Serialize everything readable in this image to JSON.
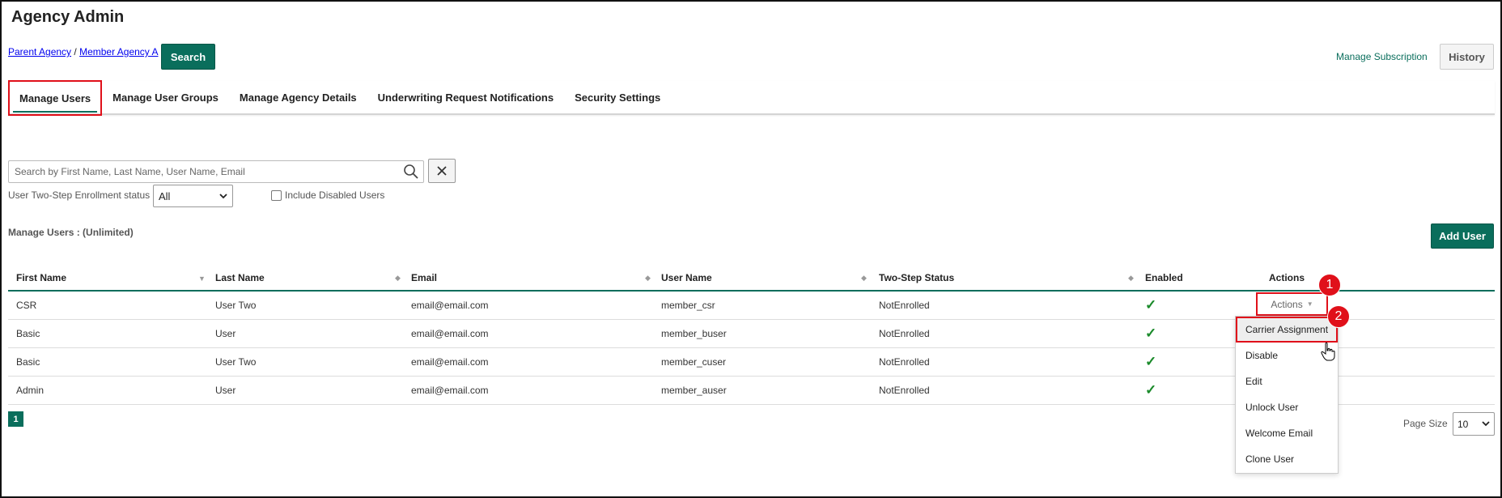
{
  "page": {
    "title": "Agency Admin"
  },
  "breadcrumb": {
    "parent": "Parent Agency",
    "separator": "/",
    "current": "Member Agency A"
  },
  "header": {
    "search_label": "Search",
    "manage_subscription": "Manage Subscription",
    "history_label": "History"
  },
  "tabs": [
    {
      "label": "Manage Users",
      "active": true
    },
    {
      "label": "Manage User Groups"
    },
    {
      "label": "Manage Agency Details"
    },
    {
      "label": "Underwriting Request Notifications"
    },
    {
      "label": "Security Settings"
    }
  ],
  "filters": {
    "search_placeholder": "Search by First Name, Last Name, User Name, Email",
    "search_value": "",
    "enrollment_label": "User Two-Step Enrollment status",
    "enrollment_value": "All",
    "include_disabled_label": "Include Disabled Users",
    "include_disabled_checked": false
  },
  "users_section": {
    "title": "Manage Users : (Unlimited)",
    "add_user_label": "Add User"
  },
  "table": {
    "columns": [
      "First Name",
      "Last Name",
      "Email",
      "User Name",
      "Two-Step Status",
      "Enabled",
      "Actions"
    ],
    "rows": [
      {
        "first": "CSR",
        "last": "User Two",
        "email": "email@email.com",
        "username": "member_csr",
        "status": "NotEnrolled",
        "enabled": "✓"
      },
      {
        "first": "Basic",
        "last": "User",
        "email": "email@email.com",
        "username": "member_buser",
        "status": "NotEnrolled",
        "enabled": "✓"
      },
      {
        "first": "Basic",
        "last": "User Two",
        "email": "email@email.com",
        "username": "member_cuser",
        "status": "NotEnrolled",
        "enabled": "✓"
      },
      {
        "first": "Admin",
        "last": "User",
        "email": "email@email.com",
        "username": "member_auser",
        "status": "NotEnrolled",
        "enabled": "✓"
      }
    ]
  },
  "actions_button": {
    "label": "Actions"
  },
  "actions_menu": [
    "Carrier Assignment",
    "Disable",
    "Edit",
    "Unlock User",
    "Welcome Email",
    "Clone User"
  ],
  "badges": {
    "one": "1",
    "two": "2"
  },
  "pagination": {
    "current_page": "1",
    "page_size_label": "Page Size",
    "page_size_value": "10"
  },
  "colors": {
    "accent": "#0a6e5c",
    "highlight": "#e0101a",
    "check": "#1a8a2a"
  }
}
